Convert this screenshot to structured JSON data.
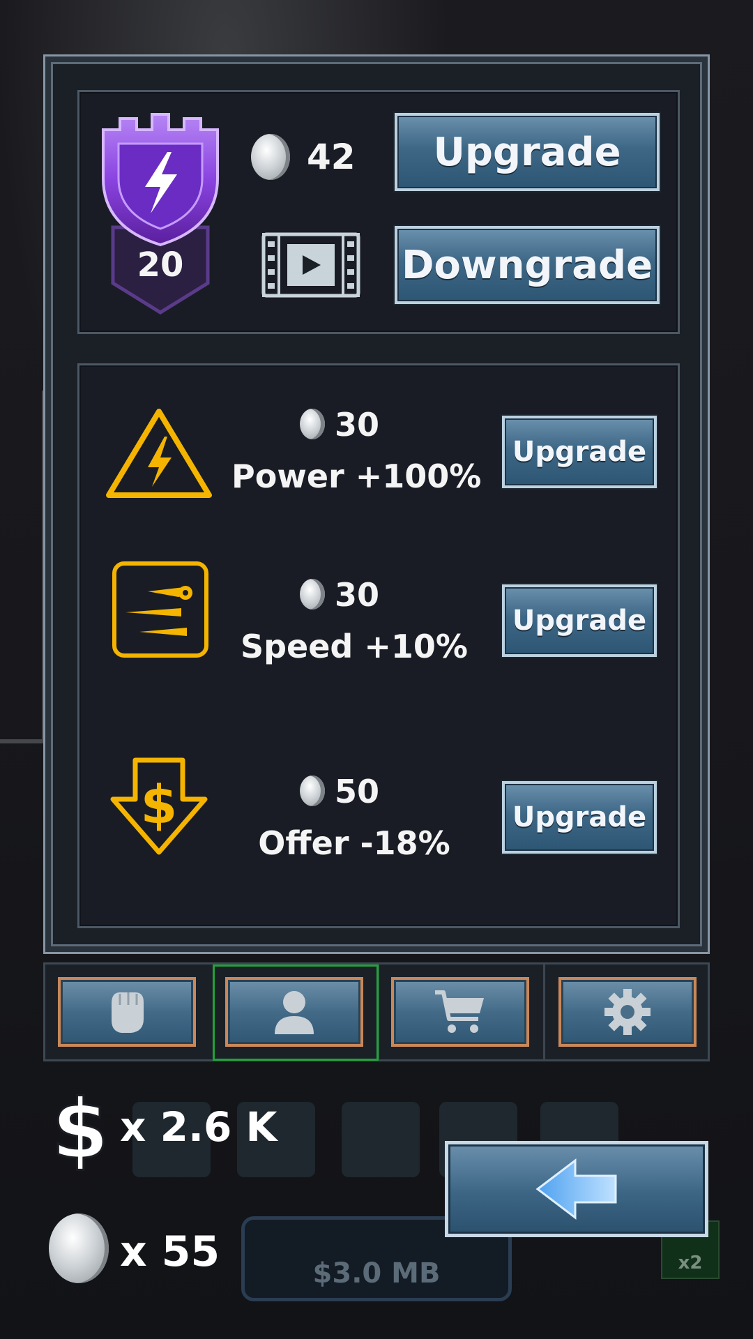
{
  "header": {
    "level": "20",
    "coin_cost": "42",
    "upgrade_label": "Upgrade",
    "downgrade_label": "Downgrade"
  },
  "upgrades": [
    {
      "icon": "lightning-warning-icon",
      "cost": "30",
      "label": "Power +100%",
      "button": "Upgrade"
    },
    {
      "icon": "speed-boost-icon",
      "cost": "30",
      "label": "Speed +10%",
      "button": "Upgrade"
    },
    {
      "icon": "price-down-icon",
      "cost": "50",
      "label": "Offer -18%",
      "button": "Upgrade"
    }
  ],
  "tabs": [
    {
      "icon": "fist-icon",
      "active": false
    },
    {
      "icon": "profile-icon",
      "active": true
    },
    {
      "icon": "cart-icon",
      "active": false
    },
    {
      "icon": "gear-icon",
      "active": false
    }
  ],
  "hud": {
    "money": "x 2.6 K",
    "coins": "x 55",
    "mb_label": "$3.0 MB",
    "multiplier": "x2"
  },
  "colors": {
    "accent_gold": "#f4b400",
    "shield_purple": "#7b3fd1",
    "active_tab": "#23a23a"
  }
}
